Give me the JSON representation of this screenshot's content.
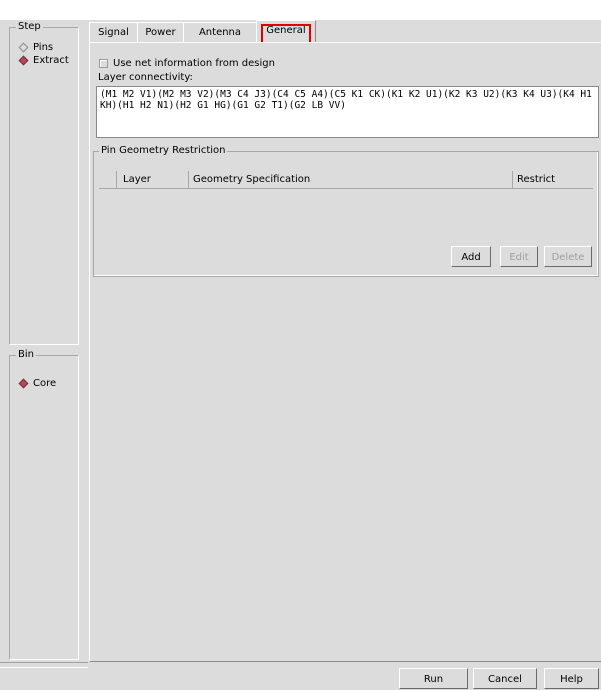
{
  "sidebar": {
    "step": {
      "title": "Step",
      "options": [
        {
          "label": "Pins",
          "selected": false
        },
        {
          "label": "Extract",
          "selected": true
        }
      ]
    },
    "bin": {
      "title": "Bin",
      "options": [
        {
          "label": "Core",
          "selected": true
        }
      ]
    }
  },
  "tabs": [
    {
      "label": "Signal"
    },
    {
      "label": "Power"
    },
    {
      "label": "Antenna"
    },
    {
      "label": "General",
      "active": true
    }
  ],
  "general": {
    "use_net_info_label": "Use net information from design",
    "use_net_info_checked": false,
    "layer_connectivity_label": "Layer connectivity:",
    "layer_connectivity_value": "(M1 M2 V1)(M2 M3 V2)(M3 C4 J3)(C4 C5 A4)(C5 K1 CK)(K1 K2 U1)(K2 K3 U2)(K3 K4 U3)(K4 H1 KH)(H1 H2 N1)(H2 G1 HG)(G1 G2 T1)(G2 LB VV)",
    "pin_geometry": {
      "title": "Pin Geometry Restriction",
      "columns": [
        "Layer",
        "Geometry Specification",
        "Restrict"
      ],
      "rows": [],
      "buttons": {
        "add": "Add",
        "edit": "Edit",
        "delete": "Delete"
      }
    }
  },
  "footer": {
    "run": "Run",
    "cancel": "Cancel",
    "help": "Help"
  },
  "colors": {
    "background": "#dcdcdc",
    "radio_selected": "#b14b5b",
    "tab_highlight": "#e00000"
  }
}
